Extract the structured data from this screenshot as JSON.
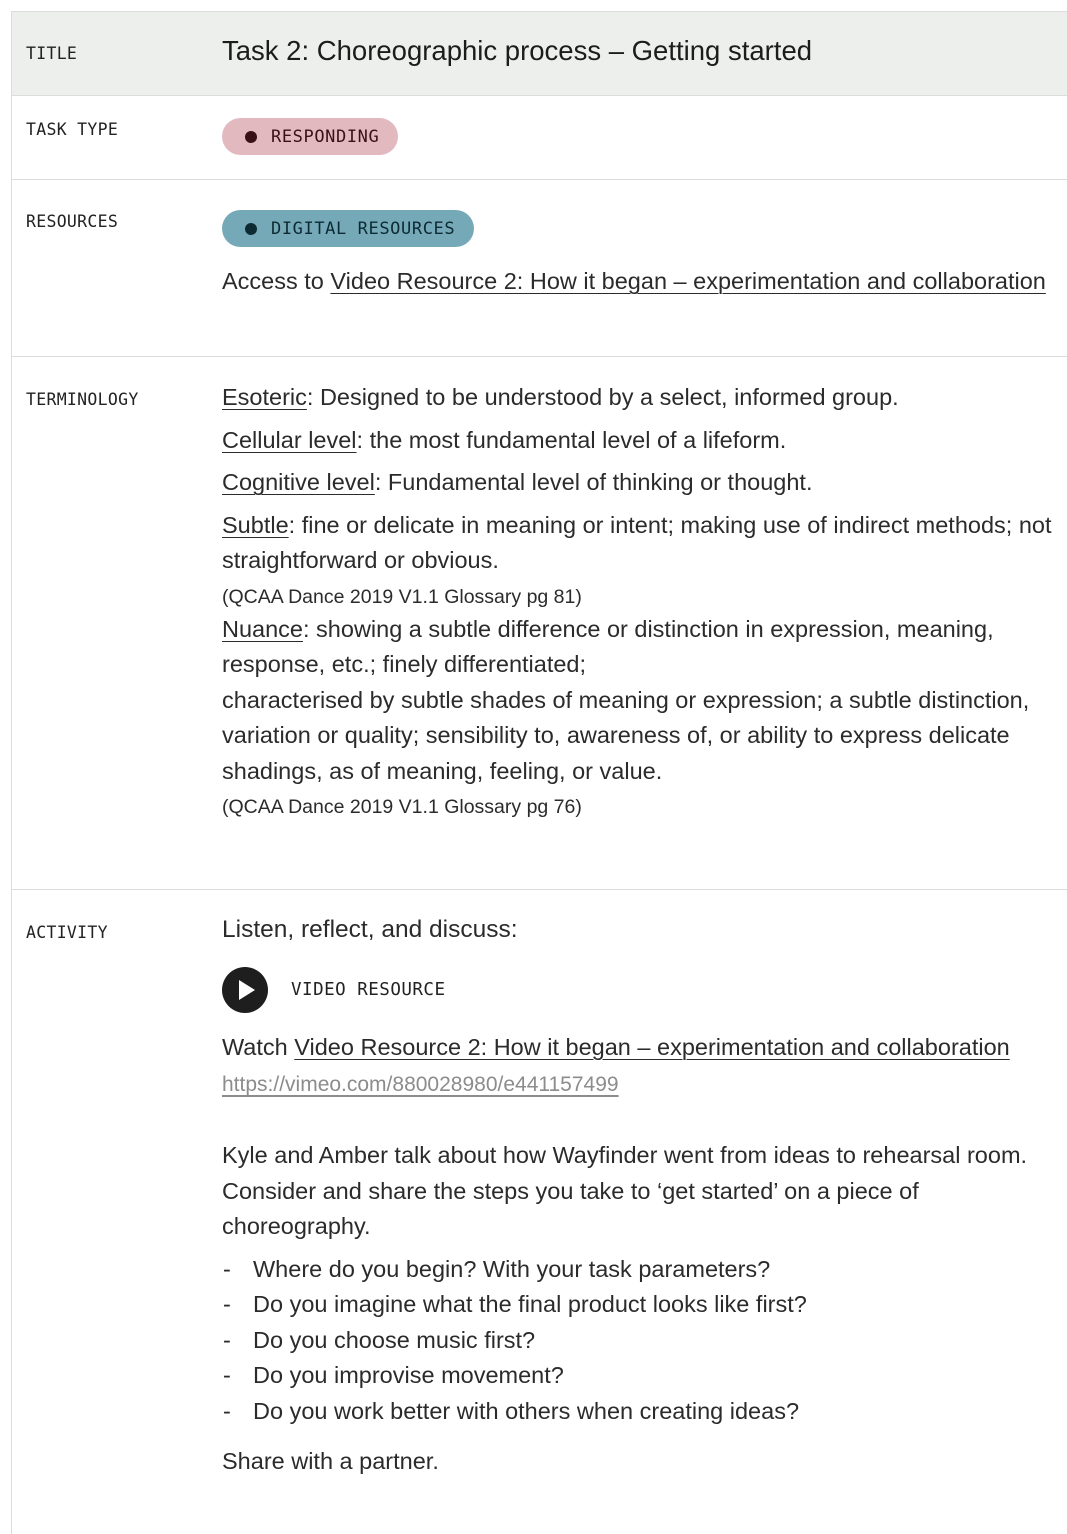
{
  "rows": {
    "title": {
      "label": "TITLE",
      "value": "Task 2: Choreographic process – Getting started"
    },
    "task_type": {
      "label": "TASK TYPE",
      "pill": "RESPONDING"
    },
    "resources": {
      "label": "RESOURCES",
      "pill": "DIGITAL RESOURCES",
      "access_prefix": "Access to ",
      "access_link": "Video Resource 2: How it began – experimentation and collaboration"
    },
    "terminology": {
      "label": "TERMINOLOGY",
      "terms": [
        {
          "term": "Esoteric",
          "definition": ": Designed to be understood by a select, informed group."
        },
        {
          "term": "Cellular level",
          "definition": ": the most fundamental level of a lifeform."
        },
        {
          "term": "Cognitive level",
          "definition": ": Fundamental level of thinking or thought."
        },
        {
          "term": "Subtle",
          "definition": ": fine or delicate in meaning or intent; making use of indirect methods; not straightforward or obvious."
        },
        {
          "term": "Nuance",
          "definition": ": showing a subtle difference or distinction in expression, meaning, response, etc.; finely differentiated;"
        }
      ],
      "citation_1": "(QCAA Dance 2019 V1.1 Glossary pg 81)",
      "nuance_continued": "characterised by subtle shades of meaning or expression; a subtle distinction, variation or quality; sensibility to, awareness of, or ability to express delicate shadings, as of meaning, feeling, or value.",
      "citation_2": "(QCAA Dance 2019 V1.1 Glossary pg 76)"
    },
    "activity": {
      "label": "ACTIVITY",
      "heading": "Listen, reflect, and discuss:",
      "video_label": "VIDEO RESOURCE",
      "watch_prefix": "Watch ",
      "watch_link": "Video Resource 2: How it began – experimentation and collaboration",
      "url": "https://vimeo.com/880028980/e441157499",
      "intro": "Kyle and Amber talk about how Wayfinder went from ideas to rehearsal room. Consider and share the steps you take to ‘get started’ on a piece of choreography.",
      "questions": [
        "Where do you begin? With your task parameters?",
        "Do you imagine what the final product looks like first?",
        "Do you choose music first?",
        "Do you improvise movement?",
        "Do you work better with others when creating ideas?"
      ],
      "closing": "Share with a partner."
    }
  },
  "colors": {
    "title_row_bg": "#edefed",
    "pill_responding": "#e3b9c0",
    "pill_digital": "#76a9b8",
    "border": "#dcdcdc",
    "url_text": "#8c8c8c"
  }
}
